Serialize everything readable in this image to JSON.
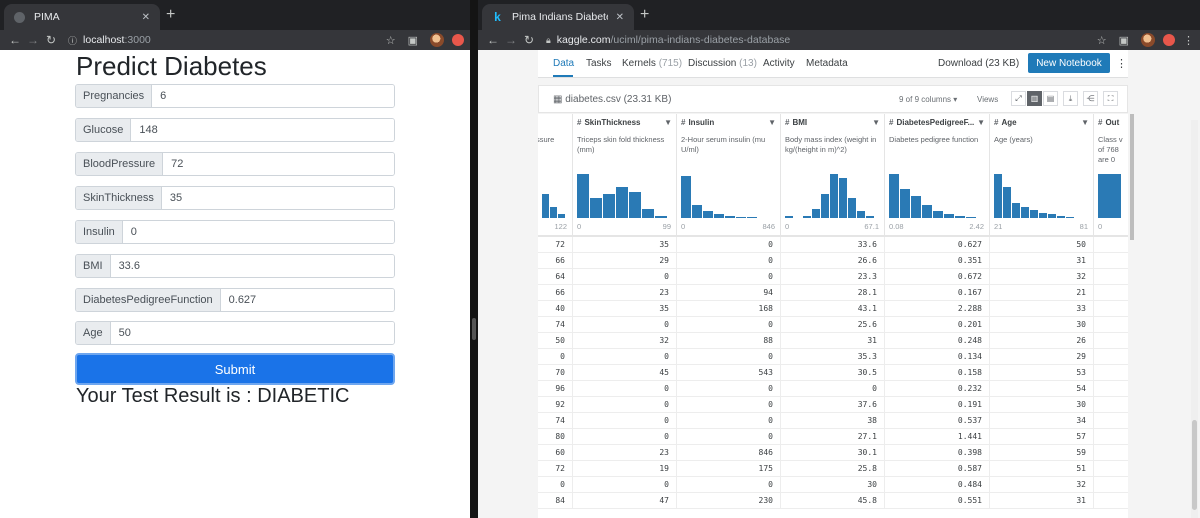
{
  "left": {
    "tab_title": "PIMA",
    "url": "localhost",
    "url_port": ":3000",
    "heading": "Predict Diabetes",
    "fields": [
      {
        "label": "Pregnancies",
        "value": "6"
      },
      {
        "label": "Glucose",
        "value": "148"
      },
      {
        "label": "BloodPressure",
        "value": "72"
      },
      {
        "label": "SkinThickness",
        "value": "35"
      },
      {
        "label": "Insulin",
        "value": "0"
      },
      {
        "label": "BMI",
        "value": "33.6"
      },
      {
        "label": "DiabetesPedigreeFunction",
        "value": "0.627"
      },
      {
        "label": "Age",
        "value": "50"
      }
    ],
    "submit_label": "Submit",
    "result_text": "Your Test Result is : DIABETIC"
  },
  "right": {
    "tab_title": "Pima Indians Diabetes Database",
    "url_host": "kaggle.com",
    "url_path": "/uciml/pima-indians-diabetes-database",
    "nav": [
      {
        "label": "Data",
        "count": ""
      },
      {
        "label": "Tasks",
        "count": ""
      },
      {
        "label": "Kernels",
        "count": "(715)"
      },
      {
        "label": "Discussion",
        "count": "(13)"
      },
      {
        "label": "Activity",
        "count": ""
      },
      {
        "label": "Metadata",
        "count": ""
      }
    ],
    "download_label": "Download (23 KB)",
    "new_notebook_label": "New Notebook",
    "file_name": "diabetes.csv (23.31 KB)",
    "columns_shown": "9 of 9 columns ▾",
    "views_label": "Views",
    "columns": [
      {
        "name": "",
        "desc": "ssure",
        "min": "",
        "max": "122",
        "hist": [
          0.55,
          0.25,
          0.1
        ]
      },
      {
        "name": "SkinThickness",
        "desc": "Triceps skin fold thickness (mm)",
        "min": "0",
        "max": "99",
        "hist": [
          1.0,
          0.45,
          0.55,
          0.7,
          0.6,
          0.2,
          0.05
        ]
      },
      {
        "name": "Insulin",
        "desc": "2-Hour serum insulin (mu U/ml)",
        "min": "0",
        "max": "846",
        "hist": [
          0.95,
          0.3,
          0.15,
          0.08,
          0.04,
          0.02,
          0.02,
          0.01
        ]
      },
      {
        "name": "BMI",
        "desc": "Body mass index (weight in kg/(height in m)^2)",
        "min": "0",
        "max": "67.1",
        "hist": [
          0.04,
          0.0,
          0.05,
          0.2,
          0.55,
          1.0,
          0.9,
          0.45,
          0.15,
          0.04
        ]
      },
      {
        "name": "DiabetesPedigreeF...",
        "desc": "Diabetes pedigree function",
        "min": "0.08",
        "max": "2.42",
        "hist": [
          1.0,
          0.65,
          0.5,
          0.3,
          0.15,
          0.08,
          0.05,
          0.03
        ]
      },
      {
        "name": "Age",
        "desc": "Age (years)",
        "min": "21",
        "max": "81",
        "hist": [
          1.0,
          0.7,
          0.35,
          0.25,
          0.18,
          0.12,
          0.08,
          0.05,
          0.02,
          0.01
        ]
      },
      {
        "name": "Out",
        "desc": "Class v of 768 are 0",
        "min": "0",
        "max": "",
        "hist": [
          1.0
        ]
      }
    ],
    "rows": [
      [
        "72",
        "35",
        "0",
        "33.6",
        "0.627",
        "50"
      ],
      [
        "66",
        "29",
        "0",
        "26.6",
        "0.351",
        "31"
      ],
      [
        "64",
        "0",
        "0",
        "23.3",
        "0.672",
        "32"
      ],
      [
        "66",
        "23",
        "94",
        "28.1",
        "0.167",
        "21"
      ],
      [
        "40",
        "35",
        "168",
        "43.1",
        "2.288",
        "33"
      ],
      [
        "74",
        "0",
        "0",
        "25.6",
        "0.201",
        "30"
      ],
      [
        "50",
        "32",
        "88",
        "31",
        "0.248",
        "26"
      ],
      [
        "0",
        "0",
        "0",
        "35.3",
        "0.134",
        "29"
      ],
      [
        "70",
        "45",
        "543",
        "30.5",
        "0.158",
        "53"
      ],
      [
        "96",
        "0",
        "0",
        "0",
        "0.232",
        "54"
      ],
      [
        "92",
        "0",
        "0",
        "37.6",
        "0.191",
        "30"
      ],
      [
        "74",
        "0",
        "0",
        "38",
        "0.537",
        "34"
      ],
      [
        "80",
        "0",
        "0",
        "27.1",
        "1.441",
        "57"
      ],
      [
        "60",
        "23",
        "846",
        "30.1",
        "0.398",
        "59"
      ],
      [
        "72",
        "19",
        "175",
        "25.8",
        "0.587",
        "51"
      ],
      [
        "0",
        "0",
        "0",
        "30",
        "0.484",
        "32"
      ],
      [
        "84",
        "47",
        "230",
        "45.8",
        "0.551",
        "31"
      ]
    ]
  },
  "colors": {
    "accent": "#1a73e8",
    "kaggle_blue": "#1f7ab8",
    "hist_bar": "#2a7ab5"
  }
}
